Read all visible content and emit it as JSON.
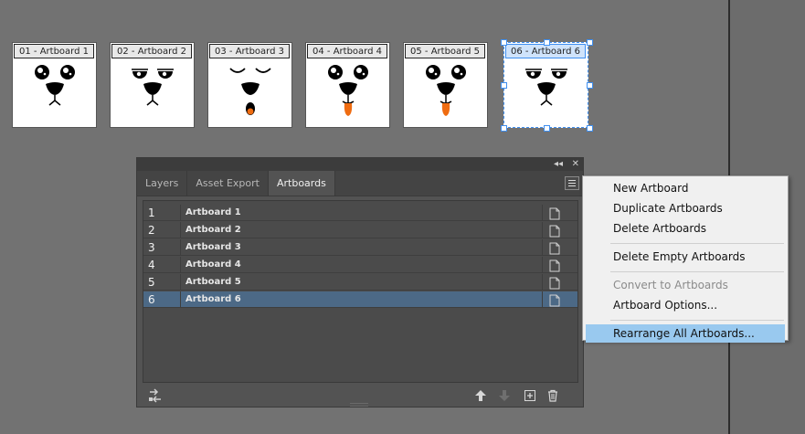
{
  "artboards": [
    {
      "label": "01 - Artboard 1",
      "eyes": "round",
      "mouth": "none",
      "selected": false
    },
    {
      "label": "02 - Artboard 2",
      "eyes": "half",
      "mouth": "none",
      "selected": false
    },
    {
      "label": "03 - Artboard 3",
      "eyes": "closed",
      "mouth": "open",
      "selected": false
    },
    {
      "label": "04 - Artboard 4",
      "eyes": "round",
      "mouth": "tongue",
      "selected": false
    },
    {
      "label": "05 - Artboard 5",
      "eyes": "round",
      "mouth": "tongue",
      "selected": false
    },
    {
      "label": "06 - Artboard 6",
      "eyes": "half",
      "mouth": "none",
      "selected": true
    }
  ],
  "panel": {
    "collapse_glyph": "◂◂",
    "close_glyph": "✕",
    "tabs": [
      {
        "label": "Layers",
        "active": false
      },
      {
        "label": "Asset Export",
        "active": false
      },
      {
        "label": "Artboards",
        "active": true
      }
    ],
    "rows": [
      {
        "num": "1",
        "name": "Artboard 1",
        "selected": false
      },
      {
        "num": "2",
        "name": "Artboard 2",
        "selected": false
      },
      {
        "num": "3",
        "name": "Artboard 3",
        "selected": false
      },
      {
        "num": "4",
        "name": "Artboard 4",
        "selected": false
      },
      {
        "num": "5",
        "name": "Artboard 5",
        "selected": false
      },
      {
        "num": "6",
        "name": "Artboard 6",
        "selected": true
      }
    ],
    "footer_icons": [
      "rearrange-icon",
      "move-up-icon",
      "move-down-icon",
      "new-artboard-icon",
      "delete-icon"
    ]
  },
  "context_menu": {
    "items": [
      {
        "label": "New Artboard",
        "disabled": false,
        "highlighted": false
      },
      {
        "label": "Duplicate Artboards",
        "disabled": false,
        "highlighted": false
      },
      {
        "label": "Delete Artboards",
        "disabled": false,
        "highlighted": false
      },
      {
        "separator": true
      },
      {
        "label": "Delete Empty Artboards",
        "disabled": false,
        "highlighted": false
      },
      {
        "separator": true
      },
      {
        "label": "Convert to Artboards",
        "disabled": true,
        "highlighted": false
      },
      {
        "label": "Artboard Options...",
        "disabled": false,
        "highlighted": false
      },
      {
        "separator": true
      },
      {
        "label": "Rearrange All Artboards...",
        "disabled": false,
        "highlighted": true
      }
    ]
  },
  "colors": {
    "canvas": "#727272",
    "panel": "#535353",
    "selection_blue": "#3f8ff0",
    "row_selected": "#4c6986",
    "menu_highlight": "#99c9ef",
    "tongue": "#ef6c11"
  }
}
